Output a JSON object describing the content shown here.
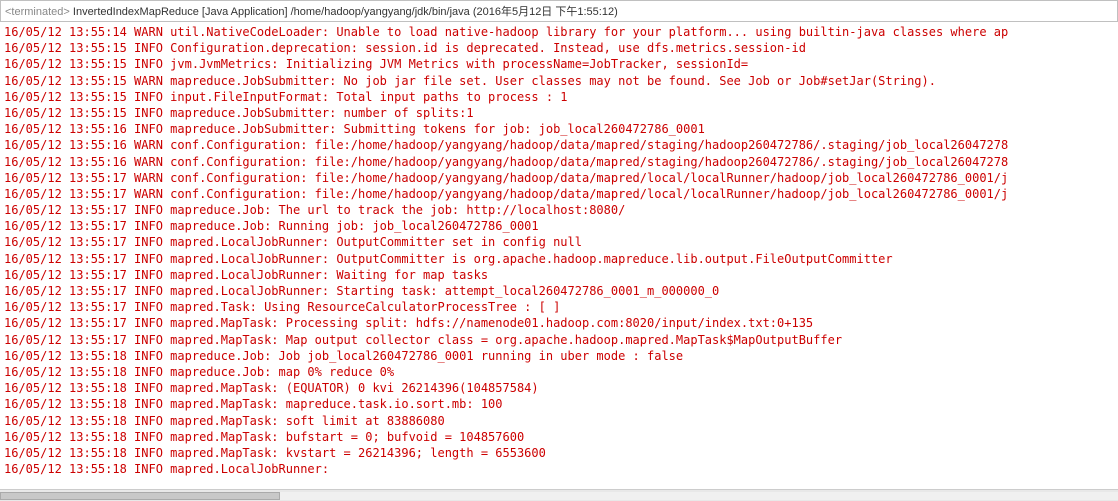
{
  "header": {
    "terminated": "<terminated>",
    "application": "InvertedIndexMapReduce [Java Application] /home/hadoop/yangyang/jdk/bin/java (2016年5月12日 下午1:55:12)"
  },
  "log_lines": [
    "16/05/12 13:55:14 WARN util.NativeCodeLoader: Unable to load native-hadoop library for your platform... using builtin-java classes where ap",
    "16/05/12 13:55:15 INFO Configuration.deprecation: session.id is deprecated. Instead, use dfs.metrics.session-id",
    "16/05/12 13:55:15 INFO jvm.JvmMetrics: Initializing JVM Metrics with processName=JobTracker, sessionId=",
    "16/05/12 13:55:15 WARN mapreduce.JobSubmitter: No job jar file set.  User classes may not be found. See Job or Job#setJar(String).",
    "16/05/12 13:55:15 INFO input.FileInputFormat: Total input paths to process : 1",
    "16/05/12 13:55:15 INFO mapreduce.JobSubmitter: number of splits:1",
    "16/05/12 13:55:16 INFO mapreduce.JobSubmitter: Submitting tokens for job: job_local260472786_0001",
    "16/05/12 13:55:16 WARN conf.Configuration: file:/home/hadoop/yangyang/hadoop/data/mapred/staging/hadoop260472786/.staging/job_local26047278",
    "16/05/12 13:55:16 WARN conf.Configuration: file:/home/hadoop/yangyang/hadoop/data/mapred/staging/hadoop260472786/.staging/job_local26047278",
    "16/05/12 13:55:17 WARN conf.Configuration: file:/home/hadoop/yangyang/hadoop/data/mapred/local/localRunner/hadoop/job_local260472786_0001/j",
    "16/05/12 13:55:17 WARN conf.Configuration: file:/home/hadoop/yangyang/hadoop/data/mapred/local/localRunner/hadoop/job_local260472786_0001/j",
    "16/05/12 13:55:17 INFO mapreduce.Job: The url to track the job: http://localhost:8080/",
    "16/05/12 13:55:17 INFO mapreduce.Job: Running job: job_local260472786_0001",
    "16/05/12 13:55:17 INFO mapred.LocalJobRunner: OutputCommitter set in config null",
    "16/05/12 13:55:17 INFO mapred.LocalJobRunner: OutputCommitter is org.apache.hadoop.mapreduce.lib.output.FileOutputCommitter",
    "16/05/12 13:55:17 INFO mapred.LocalJobRunner: Waiting for map tasks",
    "16/05/12 13:55:17 INFO mapred.LocalJobRunner: Starting task: attempt_local260472786_0001_m_000000_0",
    "16/05/12 13:55:17 INFO mapred.Task:  Using ResourceCalculatorProcessTree : [ ]",
    "16/05/12 13:55:17 INFO mapred.MapTask: Processing split: hdfs://namenode01.hadoop.com:8020/input/index.txt:0+135",
    "16/05/12 13:55:17 INFO mapred.MapTask: Map output collector class = org.apache.hadoop.mapred.MapTask$MapOutputBuffer",
    "16/05/12 13:55:18 INFO mapreduce.Job: Job job_local260472786_0001 running in uber mode : false",
    "16/05/12 13:55:18 INFO mapreduce.Job:  map 0% reduce 0%",
    "16/05/12 13:55:18 INFO mapred.MapTask: (EQUATOR) 0 kvi 26214396(104857584)",
    "16/05/12 13:55:18 INFO mapred.MapTask: mapreduce.task.io.sort.mb: 100",
    "16/05/12 13:55:18 INFO mapred.MapTask: soft limit at 83886080",
    "16/05/12 13:55:18 INFO mapred.MapTask: bufstart = 0; bufvoid = 104857600",
    "16/05/12 13:55:18 INFO mapred.MapTask: kvstart = 26214396; length = 6553600",
    "16/05/12 13:55:18 INFO mapred.LocalJobRunner: "
  ]
}
